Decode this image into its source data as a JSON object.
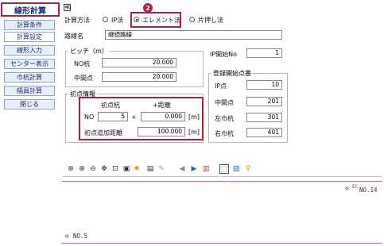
{
  "sidebar": {
    "title": "線形計算",
    "items": [
      {
        "label": "計算条件"
      },
      {
        "label": "計算設定"
      },
      {
        "label": "線形入力"
      },
      {
        "label": "センター表示"
      },
      {
        "label": "巾杭計算"
      },
      {
        "label": "幅員計算"
      },
      {
        "label": "閉じる"
      }
    ]
  },
  "header": {
    "collapse_glyph": "≪",
    "method_label": "計算方法",
    "method_options": [
      "IP法",
      "エレメント法",
      "片押し法"
    ],
    "selected_method": "エレメント法",
    "step_badge": "2"
  },
  "route": {
    "label": "路線名",
    "value": "継続路線"
  },
  "pitch": {
    "title": "ピッチ（m）",
    "no_label": "NO杭",
    "no_value": "20.000",
    "mid_label": "中間点",
    "mid_value": "20.000"
  },
  "ip_start": {
    "label": "IP開始No",
    "value": "1"
  },
  "initial": {
    "title": "初点情報",
    "col_pile": "初点杭",
    "col_add": "+距離",
    "no_label": "NO",
    "no_value": "5",
    "plus": "+",
    "add_value": "0.000",
    "unit": "[m]",
    "extra_label": "初点追加距離",
    "extra_value": "100.000",
    "extra_unit": "[m]"
  },
  "register": {
    "title": "登録開始点番",
    "rows": [
      {
        "label": "IP点",
        "value": "10"
      },
      {
        "label": "中間点",
        "value": "201"
      },
      {
        "label": "左巾杭",
        "value": "301"
      },
      {
        "label": "右巾杭",
        "value": "401"
      }
    ]
  },
  "toolbar": {
    "icons": [
      "zoom-fit-icon",
      "zoom-in-icon",
      "zoom-out-icon",
      "pan-icon",
      "zoom-window-icon",
      "redraw-icon",
      "light-icon",
      "print-icon",
      "pen-icon",
      "prev-icon",
      "next-icon",
      "save-icon",
      "select-icon",
      "select-all-icon",
      "search-icon"
    ]
  },
  "drawing": {
    "end_label": "NO.14",
    "start_label": "NO.5",
    "end_marker": "⊙",
    "start_marker": "⊙",
    "end_extra": "EC"
  },
  "colors": {
    "accent": "#b01e3c",
    "sidebar_text": "#1c2f6b",
    "line": "#d34fd3"
  }
}
